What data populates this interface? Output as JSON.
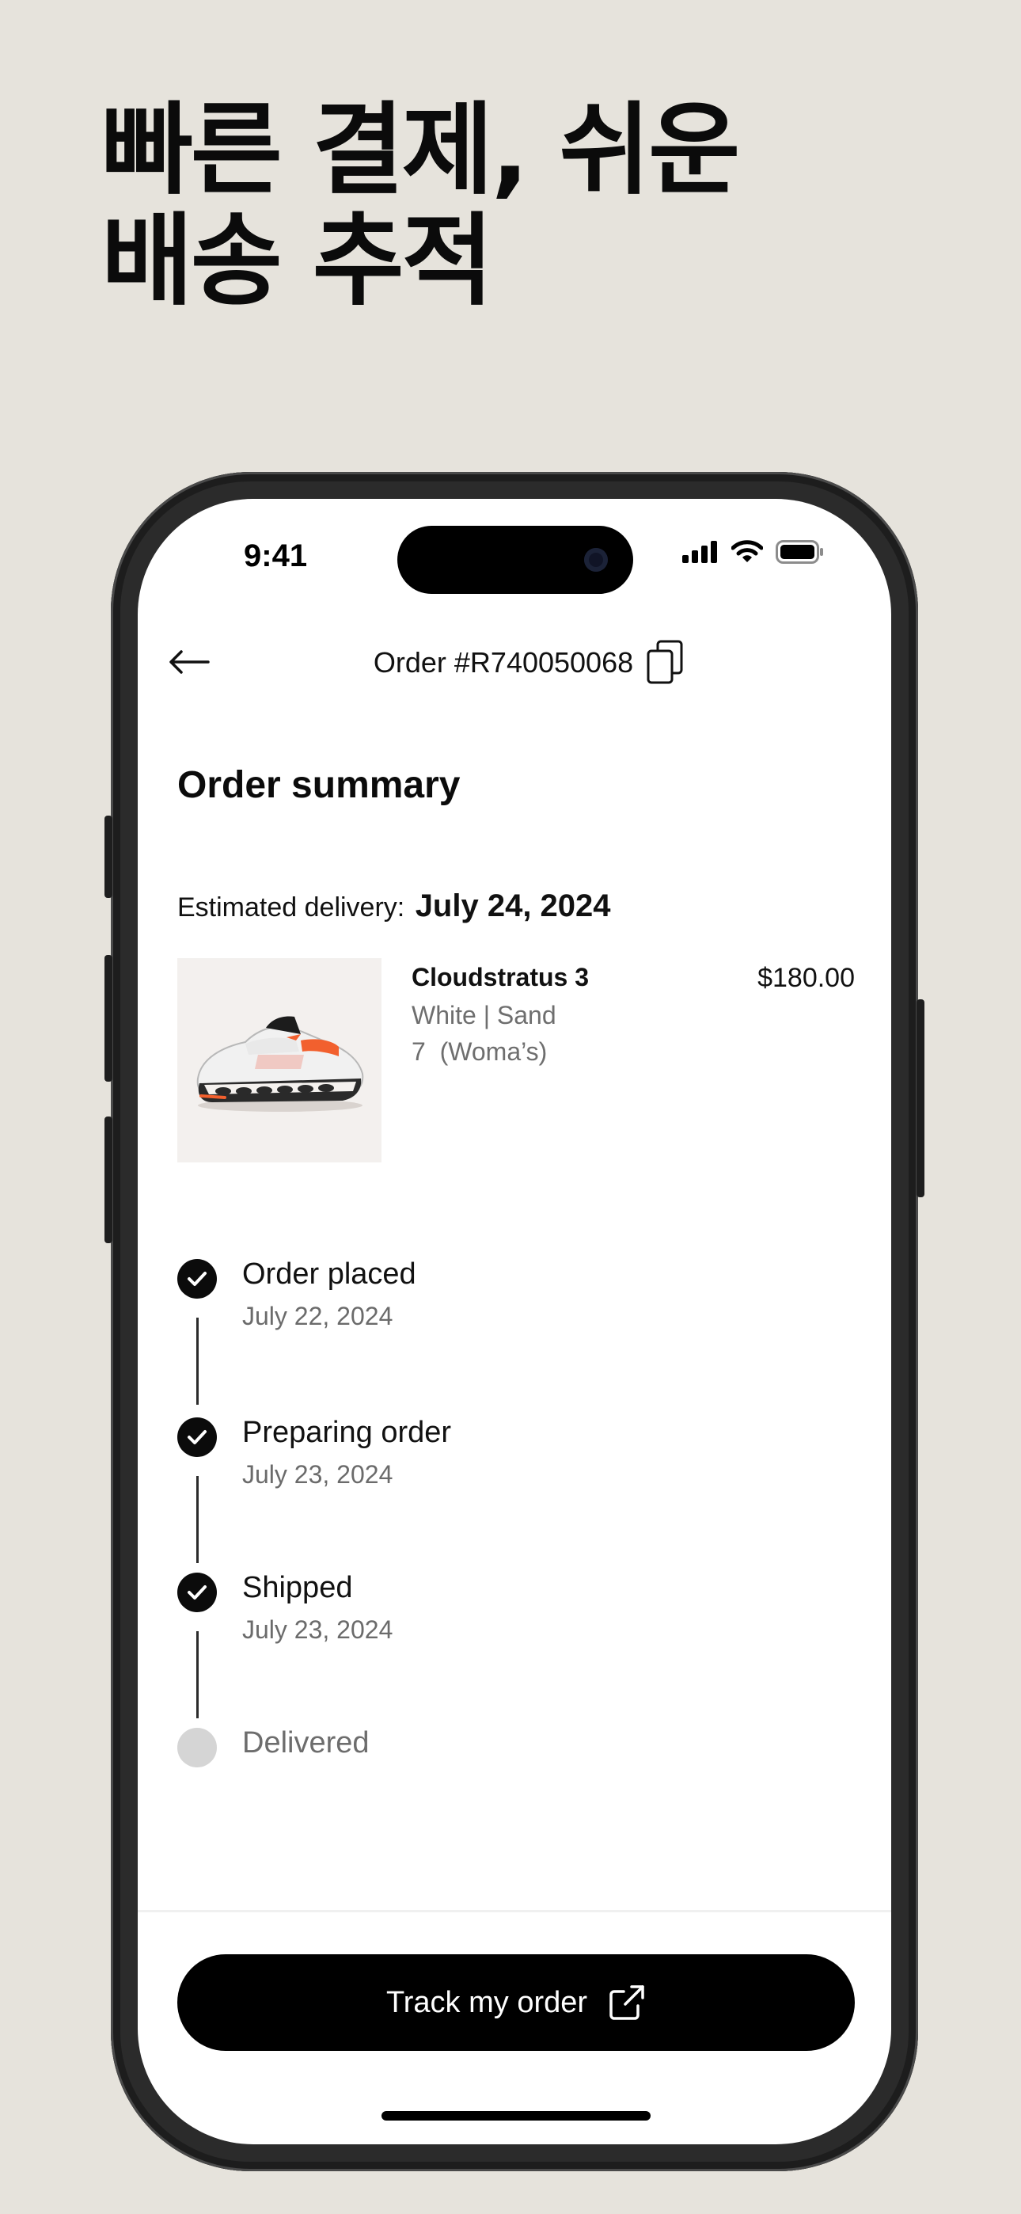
{
  "headline": {
    "line1": "빠른 결제, 쉬운",
    "line2": "배송 추적"
  },
  "status_bar": {
    "time": "9:41"
  },
  "nav": {
    "order_number": "Order #R740050068"
  },
  "summary": {
    "title": "Order summary",
    "delivery_label": "Estimated delivery:",
    "delivery_date": "July 24, 2024"
  },
  "product": {
    "name": "Cloudstratus 3",
    "variant": "White | Sand",
    "size": "7  (Woma’s)",
    "price": "$180.00"
  },
  "timeline": {
    "steps": [
      {
        "title": "Order placed",
        "date": "July 22, 2024",
        "status": "done"
      },
      {
        "title": "Preparing order",
        "date": "July 23, 2024",
        "status": "done"
      },
      {
        "title": "Shipped",
        "date": "July 23, 2024",
        "status": "done"
      },
      {
        "title": "Delivered",
        "status": "pending"
      }
    ]
  },
  "cta": {
    "track_label": "Track my order"
  },
  "colors": {
    "background": "#e6e3dc",
    "accent": "#000000",
    "pending": "#d5d5d5",
    "shoe_accent": "#f2602e"
  }
}
